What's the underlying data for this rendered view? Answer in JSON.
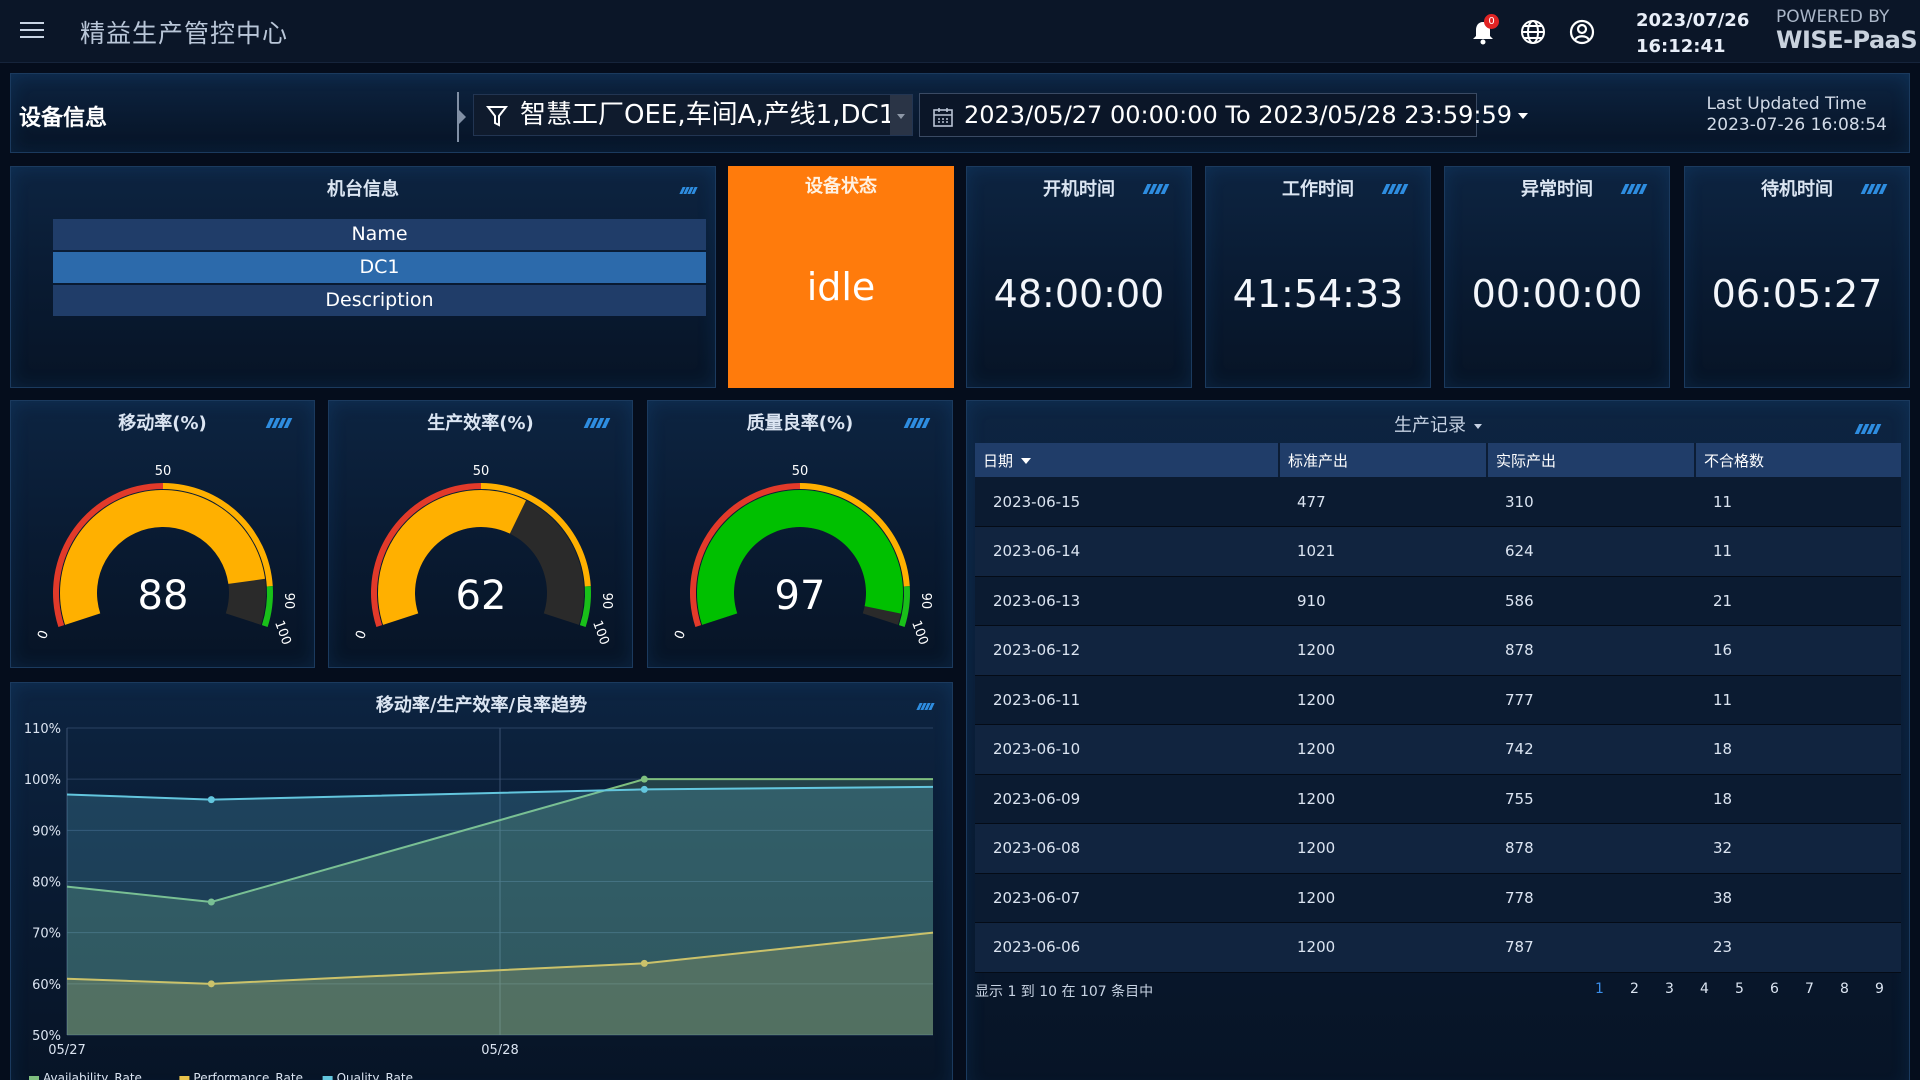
{
  "header": {
    "app_title": "精益生产管控中心",
    "notification_count": "0",
    "date": "2023/07/26",
    "time": "16:12:41",
    "powered_by_line1": "POWERED BY",
    "powered_by_line2": "WISE-PaaS",
    "icons": [
      "menu-icon",
      "bell-icon",
      "globe-icon",
      "user-icon"
    ]
  },
  "filter_bar": {
    "section_label": "设备信息",
    "filter_value": "智慧工厂OEE,车间A,产线1,DC1",
    "date_range": "2023/05/27 00:00:00 To 2023/05/28 23:59:59",
    "last_updated_label": "Last Updated Time",
    "last_updated_value": "2023-07-26 16:08:54"
  },
  "machine_info": {
    "title": "机台信息",
    "rows": [
      "Name",
      "DC1",
      "Description"
    ],
    "selected_row": 1
  },
  "status": {
    "title": "设备状态",
    "value": "idle",
    "color": "#ff7b0c"
  },
  "time_cards": [
    {
      "title": "开机时间",
      "value": "48:00:00"
    },
    {
      "title": "工作时间",
      "value": "41:54:33"
    },
    {
      "title": "异常时间",
      "value": "00:00:00"
    },
    {
      "title": "待机时间",
      "value": "06:05:27"
    }
  ],
  "gauges": [
    {
      "title": "移动率(%)",
      "value": 88,
      "display": "88",
      "min_label": "0",
      "mid_label": "50",
      "max_label": "100",
      "edge_label": "90",
      "fill_color": "#ffb000"
    },
    {
      "title": "生产效率(%)",
      "value": 62,
      "display": "62",
      "min_label": "0",
      "mid_label": "50",
      "max_label": "100",
      "edge_label": "90",
      "fill_color": "#ffb000"
    },
    {
      "title": "质量良率(%)",
      "value": 97,
      "display": "97",
      "min_label": "0",
      "mid_label": "50",
      "max_label": "100",
      "edge_label": "90",
      "fill_color": "#00c000"
    }
  ],
  "trend": {
    "title": "移动率/生产效率/良率趋势"
  },
  "chart_data": {
    "type": "area",
    "title": "移动率/生产效率/良率趋势",
    "x_tick_labels": [
      "05/27",
      "05/28"
    ],
    "x": [
      "05/27",
      "05/27 08:00",
      "05/27 16:00",
      "05/28 00:00",
      "05/28 08:00",
      "05/28 16:00",
      "05/28 24:00"
    ],
    "y_tick_labels": [
      "110%",
      "100%",
      "90%",
      "80%",
      "70%",
      "60%",
      "50%"
    ],
    "ylim": [
      50,
      110
    ],
    "grid": true,
    "legend_position": "bottom-left",
    "series": [
      {
        "name": "Availability_Rate",
        "color": "#7fbf7f",
        "values": [
          79,
          76,
          null,
          null,
          100,
          null,
          100
        ]
      },
      {
        "name": "Performance_Rate",
        "color": "#e8c24a",
        "values": [
          61,
          60,
          null,
          null,
          64,
          null,
          70
        ]
      },
      {
        "name": "Quality_Rate",
        "color": "#63c6de",
        "values": [
          97,
          96,
          null,
          null,
          98,
          null,
          98.5
        ]
      }
    ]
  },
  "records": {
    "title": "生产记录",
    "columns": [
      "日期",
      "标准产出",
      "实际产出",
      "不合格数"
    ],
    "rows": [
      [
        "2023-06-15",
        "477",
        "310",
        "11"
      ],
      [
        "2023-06-14",
        "1021",
        "624",
        "11"
      ],
      [
        "2023-06-13",
        "910",
        "586",
        "21"
      ],
      [
        "2023-06-12",
        "1200",
        "878",
        "16"
      ],
      [
        "2023-06-11",
        "1200",
        "777",
        "11"
      ],
      [
        "2023-06-10",
        "1200",
        "742",
        "18"
      ],
      [
        "2023-06-09",
        "1200",
        "755",
        "18"
      ],
      [
        "2023-06-08",
        "1200",
        "878",
        "32"
      ],
      [
        "2023-06-07",
        "1200",
        "778",
        "38"
      ],
      [
        "2023-06-06",
        "1200",
        "787",
        "23"
      ]
    ],
    "pager_info": "显示 1 到 10 在 107 条目中",
    "pages": [
      "1",
      "2",
      "3",
      "4",
      "5",
      "6",
      "7",
      "8",
      "9"
    ],
    "active_page": "1"
  }
}
